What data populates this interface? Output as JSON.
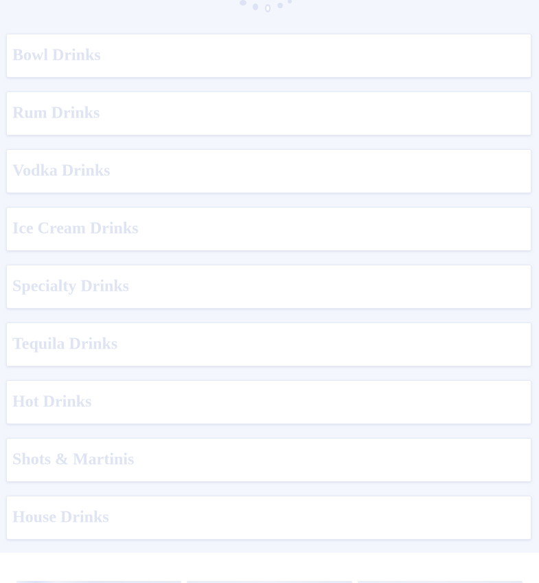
{
  "menu": {
    "categories": [
      {
        "label": "Bowl Drinks"
      },
      {
        "label": "Rum Drinks"
      },
      {
        "label": "Vodka Drinks"
      },
      {
        "label": "Ice Cream Drinks"
      },
      {
        "label": "Specialty Drinks"
      },
      {
        "label": "Tequila Drinks"
      },
      {
        "label": "Hot Drinks"
      },
      {
        "label": "Shots & Martinis"
      },
      {
        "label": "House Drinks"
      }
    ]
  },
  "loader": {
    "icon": "spinner-icon"
  },
  "colors": {
    "section_background": "#f4f6fd",
    "card_background": "#ffffff",
    "label_text": "#dfe4f3",
    "spinner": "#dde3f4"
  }
}
